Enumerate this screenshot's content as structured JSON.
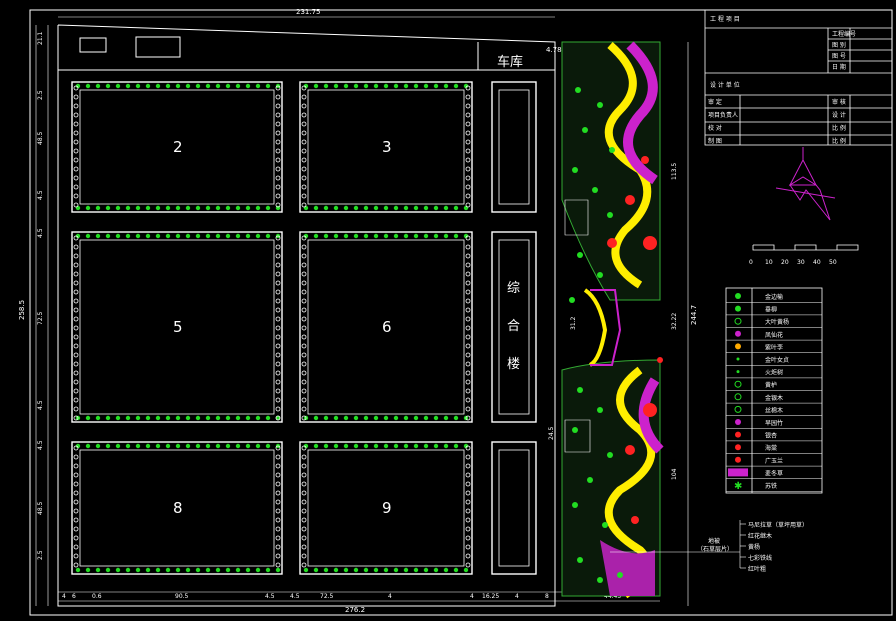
{
  "colors": {
    "background": "#000000",
    "line": "#ffffff",
    "green": "#22dd22",
    "yellow": "#ffee00",
    "magenta": "#cc22cc",
    "red": "#ff2222",
    "cyan": "#33dddd"
  },
  "plan": {
    "blocks": [
      {
        "id": "2",
        "label": "2"
      },
      {
        "id": "3",
        "label": "3"
      },
      {
        "id": "5",
        "label": "5"
      },
      {
        "id": "6",
        "label": "6"
      },
      {
        "id": "8",
        "label": "8"
      },
      {
        "id": "9",
        "label": "9"
      }
    ],
    "garage_label": "车库",
    "complex_label": [
      "综",
      "合",
      "楼"
    ]
  },
  "dimensions": {
    "top_total": "231.75",
    "bottom_total": "276.2",
    "left_total": "258.5",
    "right_total": "244.7",
    "left": [
      "21.1",
      "2.5",
      "48.5",
      "4.5",
      "4.5",
      "72.5",
      "4.5",
      "4.5",
      "48.5",
      "2.5"
    ],
    "bottom": [
      "4",
      "6",
      "0.6",
      "90.5",
      "4.5",
      "4.5",
      "72.5",
      "4",
      "4",
      "16.25",
      "4",
      "8",
      "44.45"
    ],
    "right_inner": [
      "113.5",
      "32.22",
      "31.2",
      "24.5",
      "104"
    ],
    "top_right": "4.78"
  },
  "title_block": {
    "project_row": "工 程 项 目",
    "design_unit": "设 计 单 位",
    "right_labels": [
      "工程编号",
      "图 别",
      "图 号",
      "日 期"
    ],
    "mid_labels_left": [
      "审 定",
      "项目负责人",
      "校 对",
      "制 图"
    ],
    "mid_labels_right": [
      "审 核",
      "设 计",
      "比 例",
      "比 例"
    ]
  },
  "scale_bar": {
    "ticks": [
      "0",
      "10",
      "20",
      "30",
      "40",
      "50"
    ]
  },
  "legend": [
    {
      "label": "金边榆",
      "symbol": "dot-green"
    },
    {
      "label": "垂柳",
      "symbol": "dot-green"
    },
    {
      "label": "大叶黄杨",
      "symbol": "ring-green"
    },
    {
      "label": "凤仙花",
      "symbol": "flower-magenta"
    },
    {
      "label": "紫叶李",
      "symbol": "dot-orange"
    },
    {
      "label": "金叶女贞",
      "symbol": "small-green"
    },
    {
      "label": "火炬树",
      "symbol": "small-green"
    },
    {
      "label": "黄栌",
      "symbol": "ring-green"
    },
    {
      "label": "金银木",
      "symbol": "ring-green"
    },
    {
      "label": "丝棉木",
      "symbol": "ring-green"
    },
    {
      "label": "早园竹",
      "symbol": "dot-magenta"
    },
    {
      "label": "银杏",
      "symbol": "dot-red"
    },
    {
      "label": "海棠",
      "symbol": "dot-red"
    },
    {
      "label": "广玉兰",
      "symbol": "dot-red"
    },
    {
      "label": "麦冬草",
      "symbol": "hatch-magenta"
    },
    {
      "label": "苏铁",
      "symbol": "star-green"
    }
  ],
  "callout": {
    "left": [
      "地被",
      "（石草层片）"
    ],
    "items": [
      "马尼拉草（草坪用草）",
      "红花继木",
      "黄杨",
      "七彩铁线",
      "红叶粗"
    ]
  }
}
